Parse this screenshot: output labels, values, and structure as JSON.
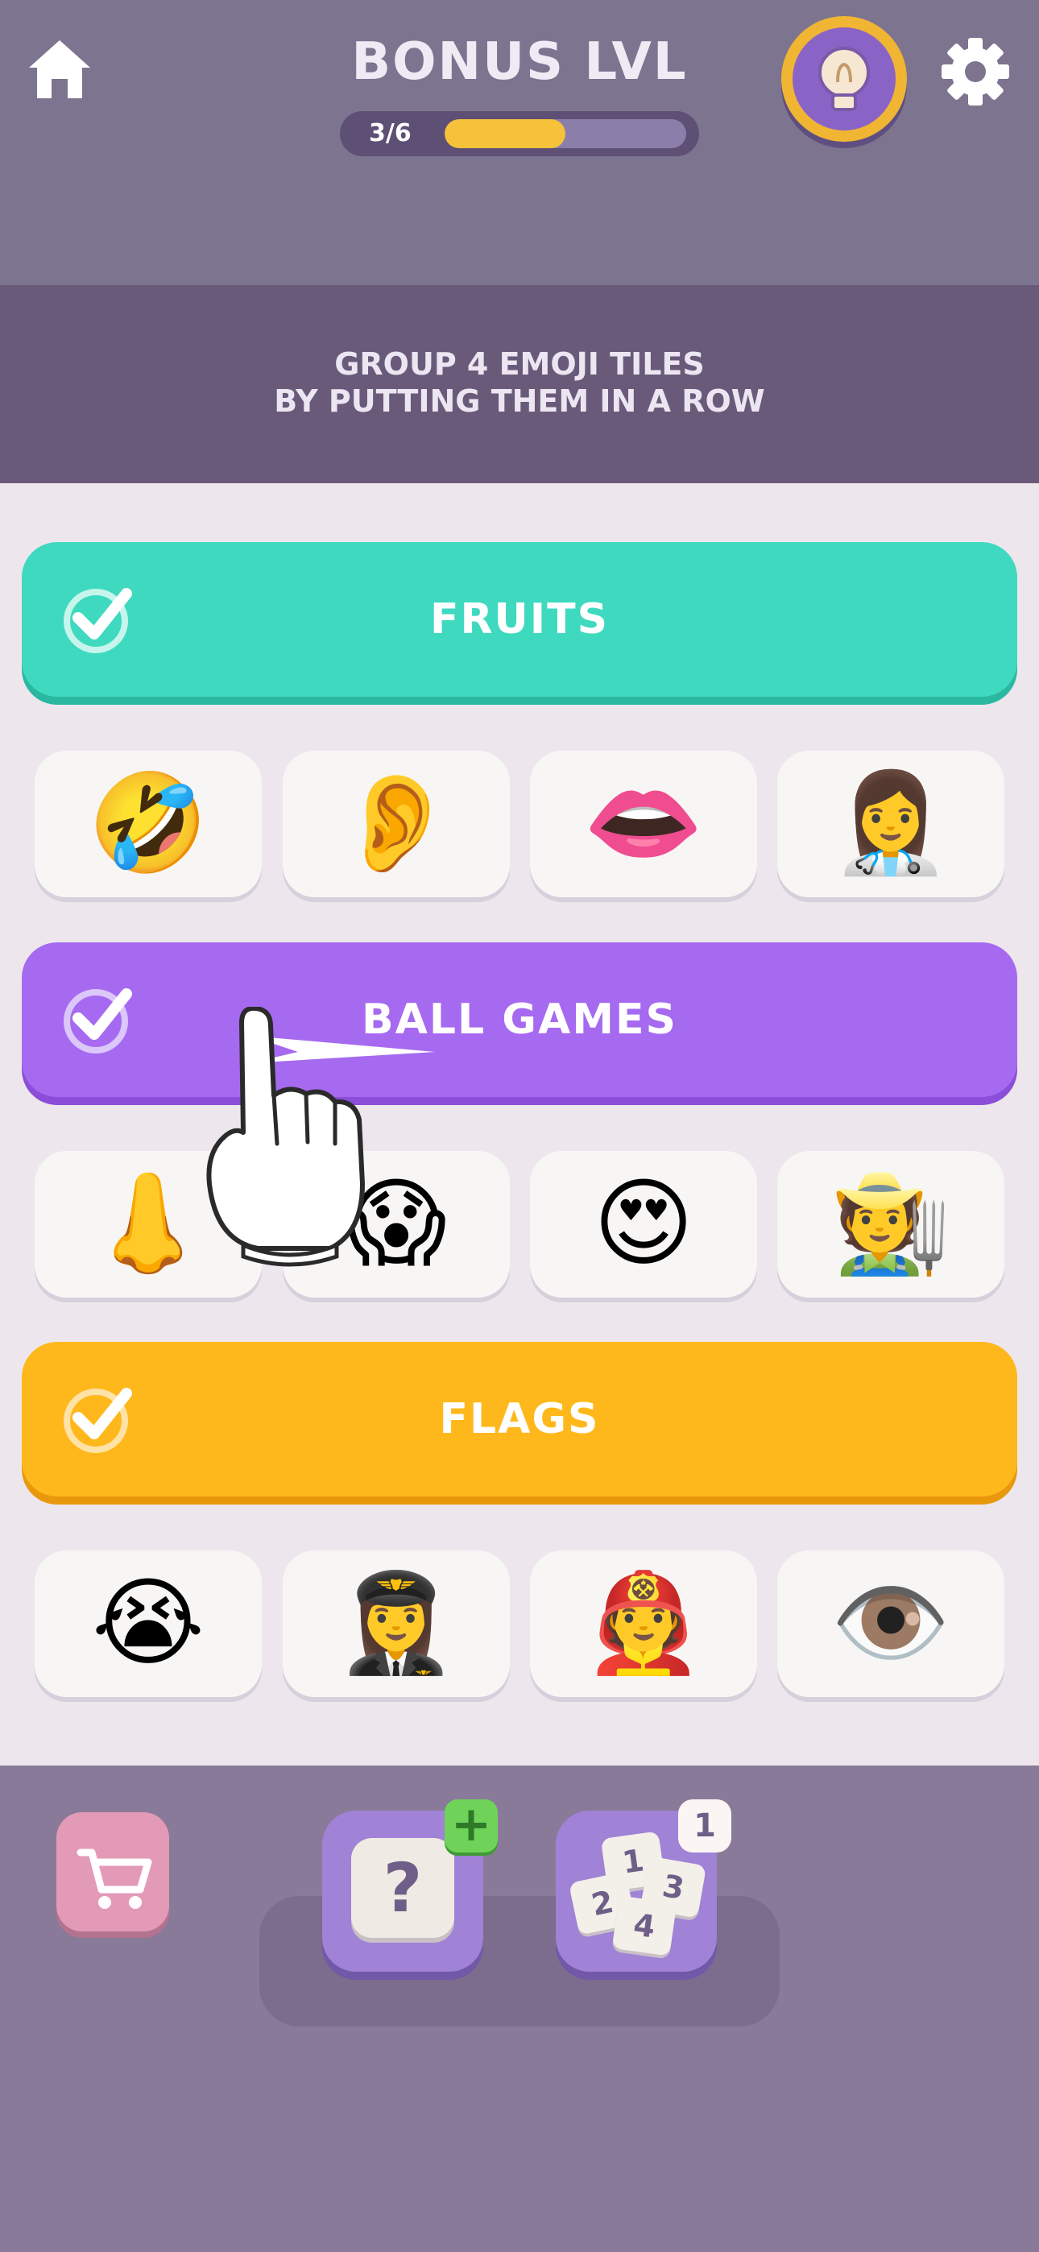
{
  "header": {
    "title": "BONUS LVL",
    "progress_text": "3/6",
    "progress_value": 0.5
  },
  "instructions": {
    "line1": "GROUP 4 EMOJI TILES",
    "line2": "BY PUTTING THEM IN A ROW"
  },
  "groups": [
    {
      "label": "FRUITS",
      "color": "#3fd9c0",
      "tiles": [
        "🤣",
        "👂",
        "👄",
        "👩‍⚕️"
      ]
    },
    {
      "label": "BALL GAMES",
      "color": "#a66af0",
      "tiles": [
        "👃",
        "😱",
        "😍",
        "🧑‍🌾"
      ]
    },
    {
      "label": "FLAGS",
      "color": "#ffb81c",
      "tiles": [
        "😭",
        "👩‍✈️",
        "🧑‍🚒",
        "👁️"
      ]
    }
  ],
  "bottom": {
    "question_mark": "?",
    "plus": "+",
    "badge_count": "1",
    "numbers": [
      "1",
      "2",
      "3",
      "4"
    ]
  },
  "icons": {
    "home": "home-icon",
    "settings": "gear-icon",
    "hint": "lightbulb-icon",
    "shop": "cart-icon",
    "check": "check-icon",
    "hand": "pointing-hand-icon"
  }
}
